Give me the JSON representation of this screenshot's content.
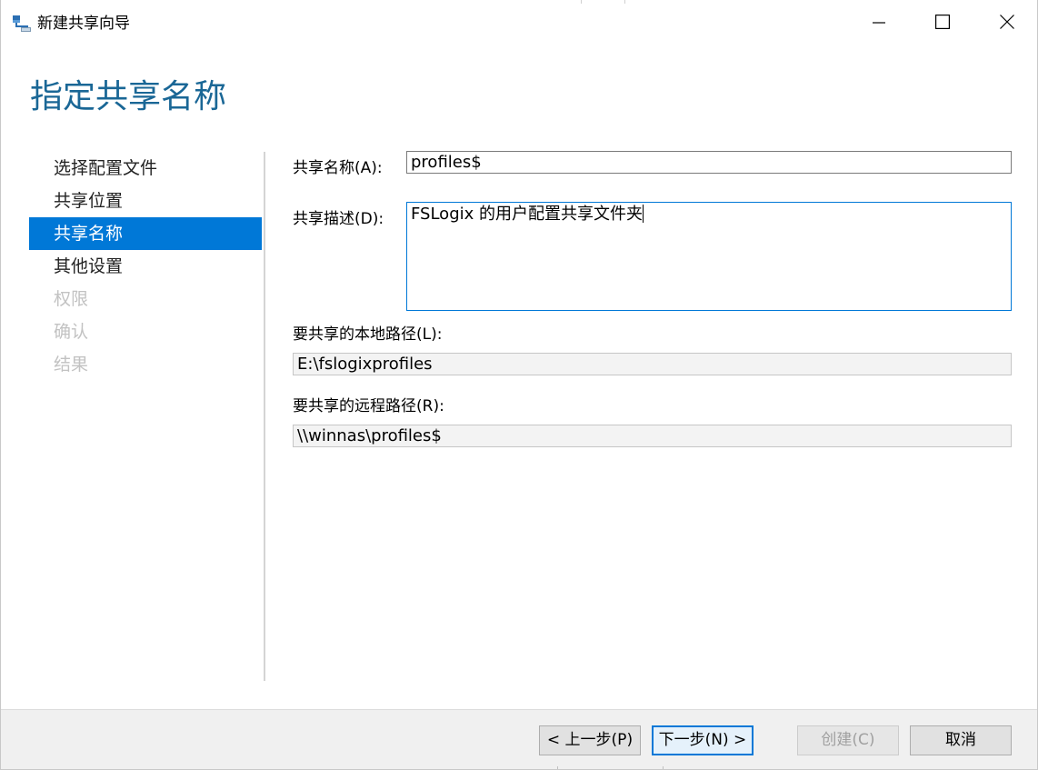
{
  "window": {
    "title": "新建共享向导"
  },
  "page": {
    "heading": "指定共享名称"
  },
  "nav": {
    "items": [
      {
        "label": "选择配置文件",
        "state": "normal"
      },
      {
        "label": "共享位置",
        "state": "normal"
      },
      {
        "label": "共享名称",
        "state": "active"
      },
      {
        "label": "其他设置",
        "state": "normal"
      },
      {
        "label": "权限",
        "state": "disabled"
      },
      {
        "label": "确认",
        "state": "disabled"
      },
      {
        "label": "结果",
        "state": "disabled"
      }
    ]
  },
  "form": {
    "share_name_label": "共享名称(A):",
    "share_name_value": "profiles$",
    "share_desc_label": "共享描述(D):",
    "share_desc_value": "FSLogix 的用户配置共享文件夹",
    "local_path_label": "要共享的本地路径(L):",
    "local_path_value": "E:\\fslogixprofiles",
    "remote_path_label": "要共享的远程路径(R):",
    "remote_path_value": "\\\\winnas\\profiles$"
  },
  "buttons": {
    "previous": "< 上一步(P)",
    "next": "下一步(N) >",
    "create": "创建(C)",
    "cancel": "取消"
  },
  "icons": {
    "app": "share-folder-icon",
    "minimize": "minimize-icon",
    "maximize": "maximize-icon",
    "close": "close-icon"
  },
  "colors": {
    "accent": "#0078d7",
    "heading": "#1a6796",
    "disabled_text": "#c2c2c2"
  }
}
